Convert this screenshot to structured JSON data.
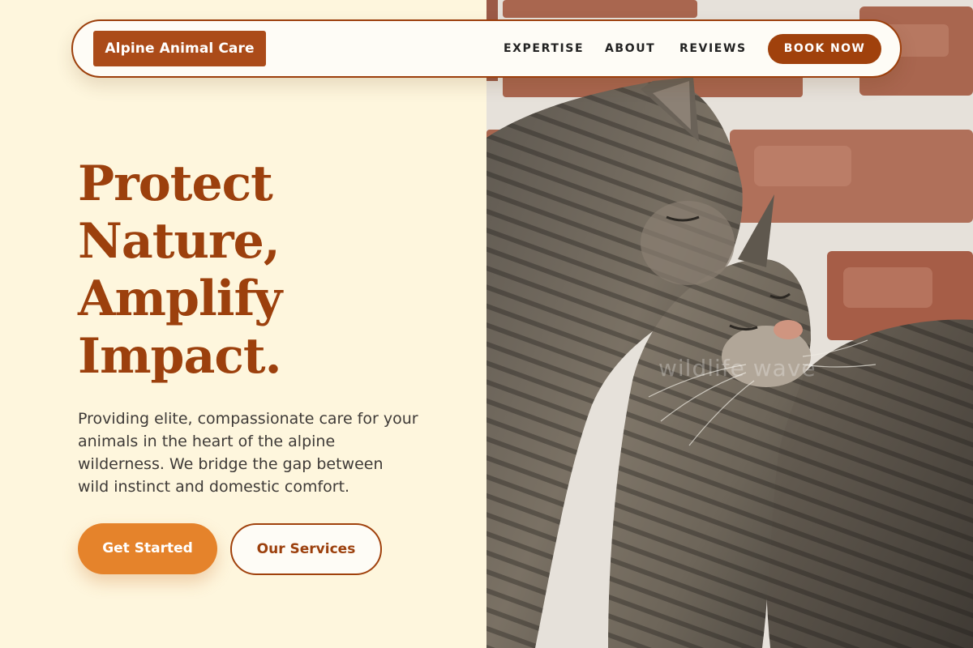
{
  "nav": {
    "brand": "Alpine Animal Care",
    "links": [
      "EXPERTISE",
      "ABOUT",
      "REVIEWS"
    ],
    "cta": "BOOK NOW"
  },
  "hero": {
    "headline_lines": [
      "Protect",
      "Nature,",
      "Amplify",
      "Impact."
    ],
    "description": "Providing elite, compassionate care for your animals in the heart of the alpine wilderness. We bridge the gap between wild instinct and domestic comfort.",
    "primary_button": "Get Started",
    "secondary_button": "Our Services"
  },
  "image": {
    "subject": "two tabby cats cuddling against a brick wall",
    "watermark": "wildlife wave"
  },
  "colors": {
    "background": "#fef6dd",
    "accent_dark": "#9c400d",
    "brand_box": "#ab4b19",
    "primary_button": "#e5832b"
  }
}
